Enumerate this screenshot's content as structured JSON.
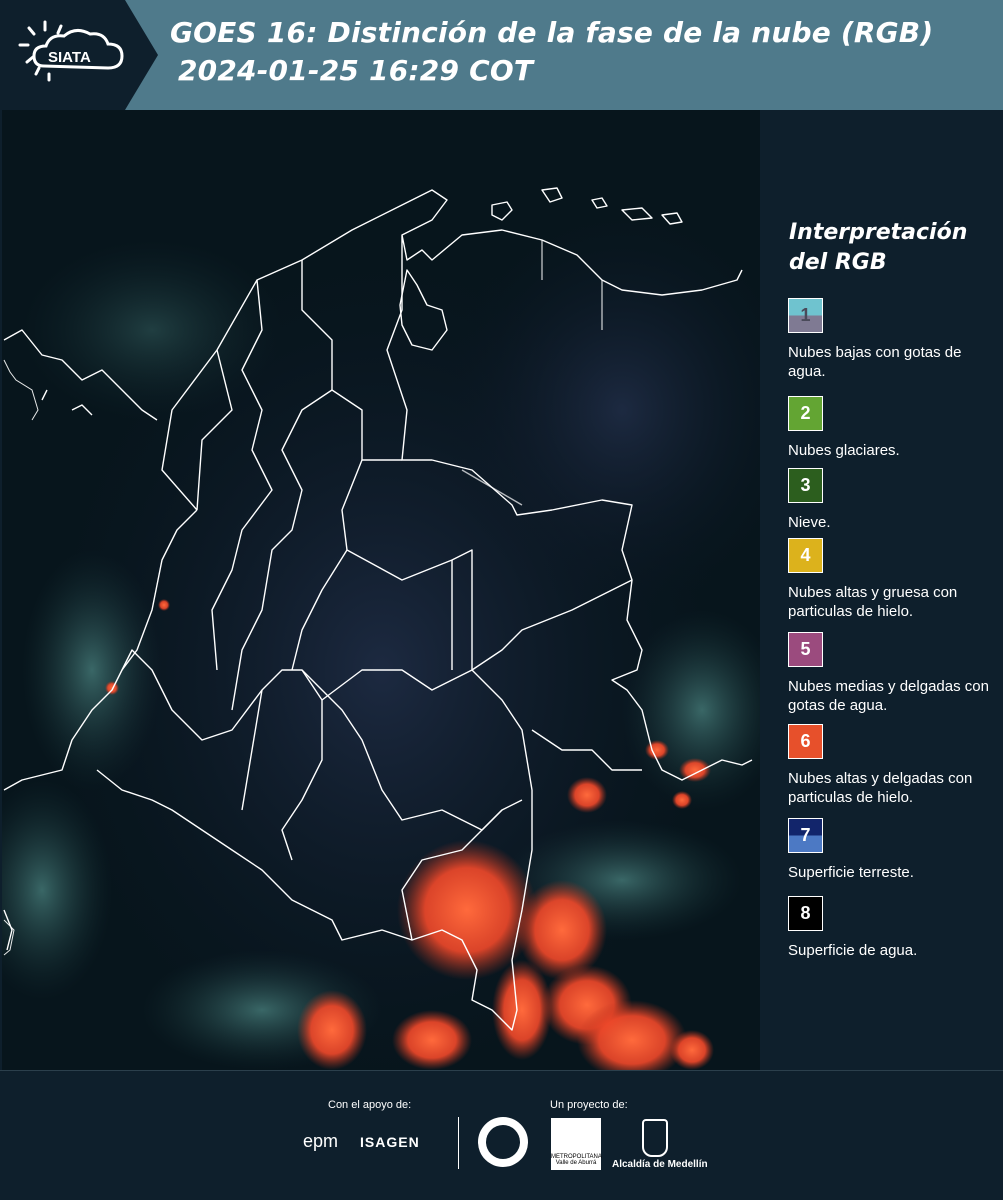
{
  "header": {
    "logo_text": "SIATA",
    "title_line1": "GOES 16: Distinción de la fase de la nube (RGB)",
    "title_line2": "2024-01-25 16:29 COT"
  },
  "legend": {
    "title_line1": "Interpretación",
    "title_line2": "del RGB",
    "items": [
      {
        "number": "1",
        "label": "Nubes bajas con gotas de agua.",
        "color_top": "#6fc3cf",
        "color_bottom": "#7f7a93",
        "number_color": "#4a4a5a"
      },
      {
        "number": "2",
        "label": "Nubes glaciares.",
        "color_top": "#63a533",
        "color_bottom": "#63a533",
        "number_color": "#ffffff"
      },
      {
        "number": "3",
        "label": "Nieve.",
        "color_top": "#2c5e1e",
        "color_bottom": "#2c5e1e",
        "number_color": "#ffffff"
      },
      {
        "number": "4",
        "label": "Nubes altas y gruesa con particulas de hielo.",
        "color_top": "#dcb21c",
        "color_bottom": "#dcb21c",
        "number_color": "#ffffff"
      },
      {
        "number": "5",
        "label": "Nubes medias y delgadas con gotas de agua.",
        "color_top": "#9b4b7e",
        "color_bottom": "#9b4b7e",
        "number_color": "#ffffff"
      },
      {
        "number": "6",
        "label": "Nubes altas y delgadas con particulas de hielo.",
        "color_top": "#e7502b",
        "color_bottom": "#e7502b",
        "number_color": "#ffffff"
      },
      {
        "number": "7",
        "label": "Superficie terreste.",
        "color_top": "#12256b",
        "color_bottom": "#4c79c4",
        "number_color": "#ffffff"
      },
      {
        "number": "8",
        "label": "Superficie de agua.",
        "color_top": "#000000",
        "color_bottom": "#000000",
        "number_color": "#ffffff"
      }
    ]
  },
  "footer": {
    "support_label": "Con el apoyo de:",
    "project_label": "Un proyecto de:",
    "sponsor1": "epm",
    "sponsor2": "ISAGEN",
    "amva_text": "METROPOLITANA Valle de Aburrá",
    "medellin": "Alcaldía de Medellín"
  },
  "colors": {
    "header_bg": "#4f7a8b",
    "page_bg": "#0e1f2c",
    "clouds_hot": "#ff5a2e"
  }
}
